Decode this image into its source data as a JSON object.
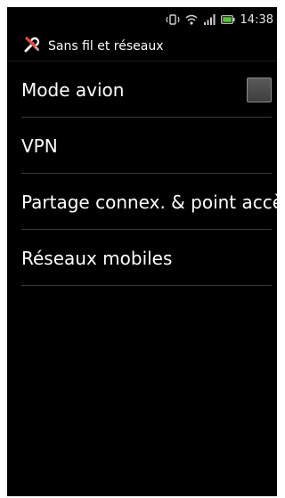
{
  "status_bar": {
    "time": "14:38",
    "icons": [
      "vibrate-icon",
      "wifi-icon",
      "signal-icon",
      "battery-icon"
    ]
  },
  "title_bar": {
    "icon": "wrench-screwdriver-icon",
    "title": "Sans fil et réseaux"
  },
  "items": [
    {
      "label": "Mode avion",
      "has_checkbox": true,
      "checked": false
    },
    {
      "label": "VPN"
    },
    {
      "label": "Partage connex. & point accè"
    },
    {
      "label": "Réseaux mobiles"
    }
  ],
  "colors": {
    "background": "#000000",
    "text": "#ffffff",
    "divider": "#3a3a3a"
  }
}
